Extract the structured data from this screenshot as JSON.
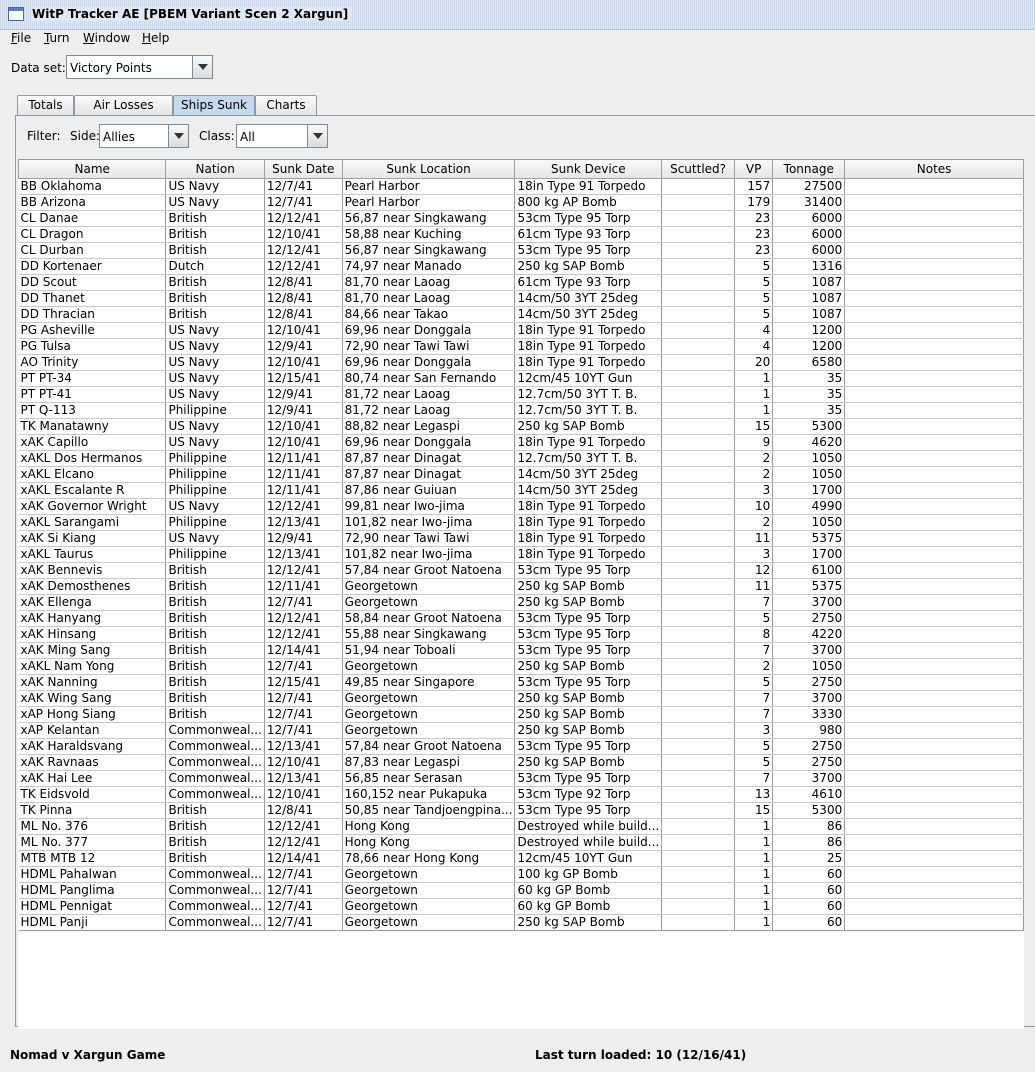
{
  "window": {
    "title": "WitP Tracker AE [PBEM Variant Scen 2 Xargun]",
    "icon": "app-window-icon"
  },
  "menu": [
    {
      "mnemonic": "F",
      "rest": "ile"
    },
    {
      "mnemonic": "T",
      "rest": "urn"
    },
    {
      "mnemonic": "W",
      "rest": "indow"
    },
    {
      "mnemonic": "H",
      "rest": "elp"
    }
  ],
  "dataset": {
    "label": "Data set:",
    "value": "Victory Points"
  },
  "tabs": [
    "Totals",
    "Air Losses",
    "Ships Sunk",
    "Charts"
  ],
  "active_tab": "Ships Sunk",
  "filter": {
    "label": "Filter:",
    "side_label": "Side:",
    "side_value": "Allies",
    "class_label": "Class:",
    "class_value": "All"
  },
  "table": {
    "columns": [
      "Name",
      "Nation",
      "Sunk Date",
      "Sunk Location",
      "Sunk Device",
      "Scuttled?",
      "VP",
      "Tonnage",
      "Notes"
    ],
    "rows": [
      [
        "BB Oklahoma",
        "US Navy",
        "12/7/41",
        "Pearl Harbor",
        "18in Type 91 Torpedo",
        "",
        "157",
        "27500",
        ""
      ],
      [
        "BB Arizona",
        "US Navy",
        "12/7/41",
        "Pearl Harbor",
        "800 kg AP Bomb",
        "",
        "179",
        "31400",
        ""
      ],
      [
        "CL Danae",
        "British",
        "12/12/41",
        "56,87 near Singkawang",
        "53cm Type 95 Torp",
        "",
        "23",
        "6000",
        ""
      ],
      [
        "CL Dragon",
        "British",
        "12/10/41",
        "58,88 near Kuching",
        "61cm Type 93 Torp",
        "",
        "23",
        "6000",
        ""
      ],
      [
        "CL Durban",
        "British",
        "12/12/41",
        "56,87 near Singkawang",
        "53cm Type 95 Torp",
        "",
        "23",
        "6000",
        ""
      ],
      [
        "DD Kortenaer",
        "Dutch",
        "12/12/41",
        "74,97 near Manado",
        "250 kg SAP Bomb",
        "",
        "5",
        "1316",
        ""
      ],
      [
        "DD Scout",
        "British",
        "12/8/41",
        "81,70 near Laoag",
        "61cm Type 93 Torp",
        "",
        "5",
        "1087",
        ""
      ],
      [
        "DD Thanet",
        "British",
        "12/8/41",
        "81,70 near Laoag",
        "14cm/50 3YT 25deg",
        "",
        "5",
        "1087",
        ""
      ],
      [
        "DD Thracian",
        "British",
        "12/8/41",
        "84,66 near Takao",
        "14cm/50 3YT 25deg",
        "",
        "5",
        "1087",
        ""
      ],
      [
        "PG Asheville",
        "US Navy",
        "12/10/41",
        "69,96 near Donggala",
        "18in Type 91 Torpedo",
        "",
        "4",
        "1200",
        ""
      ],
      [
        "PG Tulsa",
        "US Navy",
        "12/9/41",
        "72,90 near Tawi Tawi",
        "18in Type 91 Torpedo",
        "",
        "4",
        "1200",
        ""
      ],
      [
        "AO Trinity",
        "US Navy",
        "12/10/41",
        "69,96 near Donggala",
        "18in Type 91 Torpedo",
        "",
        "20",
        "6580",
        ""
      ],
      [
        "PT PT-34",
        "US Navy",
        "12/15/41",
        "80,74 near San Fernando",
        "12cm/45 10YT Gun",
        "",
        "1",
        "35",
        ""
      ],
      [
        "PT PT-41",
        "US Navy",
        "12/9/41",
        "81,72 near Laoag",
        "12.7cm/50 3YT T. B.",
        "",
        "1",
        "35",
        ""
      ],
      [
        "PT Q-113",
        "Philippine",
        "12/9/41",
        "81,72 near Laoag",
        "12.7cm/50 3YT T. B.",
        "",
        "1",
        "35",
        ""
      ],
      [
        "TK Manatawny",
        "US Navy",
        "12/10/41",
        "88,82 near Legaspi",
        "250 kg SAP Bomb",
        "",
        "15",
        "5300",
        ""
      ],
      [
        "xAK Capillo",
        "US Navy",
        "12/10/41",
        "69,96 near Donggala",
        "18in Type 91 Torpedo",
        "",
        "9",
        "4620",
        ""
      ],
      [
        "xAKL Dos Hermanos",
        "Philippine",
        "12/11/41",
        "87,87 near Dinagat",
        "12.7cm/50 3YT T. B.",
        "",
        "2",
        "1050",
        ""
      ],
      [
        "xAKL Elcano",
        "Philippine",
        "12/11/41",
        "87,87 near Dinagat",
        "14cm/50 3YT 25deg",
        "",
        "2",
        "1050",
        ""
      ],
      [
        "xAKL Escalante R",
        "Philippine",
        "12/11/41",
        "87,86 near Guiuan",
        "14cm/50 3YT 25deg",
        "",
        "3",
        "1700",
        ""
      ],
      [
        "xAK Governor Wright",
        "US Navy",
        "12/12/41",
        "99,81 near Iwo-jima",
        "18in Type 91 Torpedo",
        "",
        "10",
        "4990",
        ""
      ],
      [
        "xAKL Sarangami",
        "Philippine",
        "12/13/41",
        "101,82 near Iwo-jima",
        "18in Type 91 Torpedo",
        "",
        "2",
        "1050",
        ""
      ],
      [
        "xAK Si Kiang",
        "US Navy",
        "12/9/41",
        "72,90 near Tawi Tawi",
        "18in Type 91 Torpedo",
        "",
        "11",
        "5375",
        ""
      ],
      [
        "xAKL Taurus",
        "Philippine",
        "12/13/41",
        "101,82 near Iwo-jima",
        "18in Type 91 Torpedo",
        "",
        "3",
        "1700",
        ""
      ],
      [
        "xAK Bennevis",
        "British",
        "12/12/41",
        "57,84 near Groot Natoena",
        "53cm Type 95 Torp",
        "",
        "12",
        "6100",
        ""
      ],
      [
        "xAK Demosthenes",
        "British",
        "12/11/41",
        "Georgetown",
        "250 kg SAP Bomb",
        "",
        "11",
        "5375",
        ""
      ],
      [
        "xAK Ellenga",
        "British",
        "12/7/41",
        "Georgetown",
        "250 kg SAP Bomb",
        "",
        "7",
        "3700",
        ""
      ],
      [
        "xAK Hanyang",
        "British",
        "12/12/41",
        "58,84 near Groot Natoena",
        "53cm Type 95 Torp",
        "",
        "5",
        "2750",
        ""
      ],
      [
        "xAK Hinsang",
        "British",
        "12/12/41",
        "55,88 near Singkawang",
        "53cm Type 95 Torp",
        "",
        "8",
        "4220",
        ""
      ],
      [
        "xAK Ming Sang",
        "British",
        "12/14/41",
        "51,94 near Toboali",
        "53cm Type 95 Torp",
        "",
        "7",
        "3700",
        ""
      ],
      [
        "xAKL Nam Yong",
        "British",
        "12/7/41",
        "Georgetown",
        "250 kg SAP Bomb",
        "",
        "2",
        "1050",
        ""
      ],
      [
        "xAK Nanning",
        "British",
        "12/15/41",
        "49,85 near Singapore",
        "53cm Type 95 Torp",
        "",
        "5",
        "2750",
        ""
      ],
      [
        "xAK Wing Sang",
        "British",
        "12/7/41",
        "Georgetown",
        "250 kg SAP Bomb",
        "",
        "7",
        "3700",
        ""
      ],
      [
        "xAP Hong Siang",
        "British",
        "12/7/41",
        "Georgetown",
        "250 kg SAP Bomb",
        "",
        "7",
        "3330",
        ""
      ],
      [
        "xAP Kelantan",
        "Commonweal...",
        "12/7/41",
        "Georgetown",
        "250 kg SAP Bomb",
        "",
        "3",
        "980",
        ""
      ],
      [
        "xAK Haraldsvang",
        "Commonweal...",
        "12/13/41",
        "57,84 near Groot Natoena",
        "53cm Type 95 Torp",
        "",
        "5",
        "2750",
        ""
      ],
      [
        "xAK Ravnaas",
        "Commonweal...",
        "12/10/41",
        "87,83 near Legaspi",
        "250 kg SAP Bomb",
        "",
        "5",
        "2750",
        ""
      ],
      [
        "xAK Hai Lee",
        "Commonweal...",
        "12/13/41",
        "56,85 near Serasan",
        "53cm Type 95 Torp",
        "",
        "7",
        "3700",
        ""
      ],
      [
        "TK Eidsvold",
        "Commonweal...",
        "12/10/41",
        "160,152 near Pukapuka",
        "53cm Type 92 Torp",
        "",
        "13",
        "4610",
        ""
      ],
      [
        "TK Pinna",
        "British",
        "12/8/41",
        "50,85 near Tandjoengpina...",
        "53cm Type 95 Torp",
        "",
        "15",
        "5300",
        ""
      ],
      [
        "ML No. 376",
        "British",
        "12/12/41",
        "Hong Kong",
        "Destroyed while build...",
        "",
        "1",
        "86",
        ""
      ],
      [
        "ML No. 377",
        "British",
        "12/12/41",
        "Hong Kong",
        "Destroyed while build...",
        "",
        "1",
        "86",
        ""
      ],
      [
        "MTB MTB 12",
        "British",
        "12/14/41",
        "78,66 near Hong Kong",
        "12cm/45 10YT Gun",
        "",
        "1",
        "25",
        ""
      ],
      [
        "HDML Pahalwan",
        "Commonweal...",
        "12/7/41",
        "Georgetown",
        "100 kg GP Bomb",
        "",
        "1",
        "60",
        ""
      ],
      [
        "HDML Panglima",
        "Commonweal...",
        "12/7/41",
        "Georgetown",
        "60 kg GP Bomb",
        "",
        "1",
        "60",
        ""
      ],
      [
        "HDML Pennigat",
        "Commonweal...",
        "12/7/41",
        "Georgetown",
        "60 kg GP Bomb",
        "",
        "1",
        "60",
        ""
      ],
      [
        "HDML Panji",
        "Commonweal...",
        "12/7/41",
        "Georgetown",
        "250 kg SAP Bomb",
        "",
        "1",
        "60",
        ""
      ]
    ]
  },
  "status": {
    "left": "Nomad v Xargun Game",
    "right": "Last turn loaded: 10 (12/16/41)"
  }
}
